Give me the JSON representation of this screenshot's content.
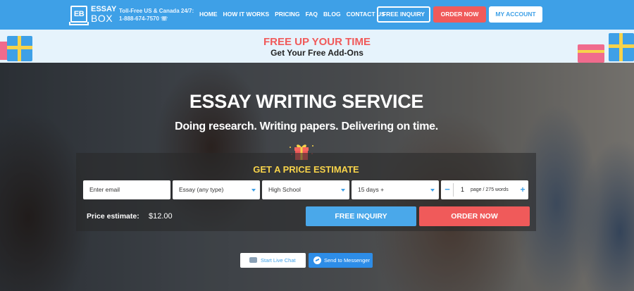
{
  "brand": {
    "logo_mark": "EB",
    "logo_line1": "ESSAY",
    "logo_line2": "BOX"
  },
  "contact": {
    "label": "Toll-Free US & Canada 24/7:",
    "phone": "1-888-674-7570"
  },
  "nav": [
    "HOME",
    "HOW IT WORKS",
    "PRICING",
    "FAQ",
    "BLOG",
    "CONTACT US"
  ],
  "header_buttons": {
    "free_inquiry": "FREE INQUIRY",
    "order_now": "ORDER NOW",
    "my_account": "MY ACCOUNT"
  },
  "promo": {
    "title": "FREE UP YOUR TIME",
    "subtitle": "Get Your Free Add-Ons"
  },
  "hero": {
    "title": "ESSAY WRITING SERVICE",
    "subtitle": "Doing research. Writing papers. Delivering on time."
  },
  "estimate": {
    "title": "GET A PRICE ESTIMATE",
    "email_placeholder": "Enter email",
    "paper_type": "Essay (any type)",
    "level": "High School",
    "deadline": "15 days +",
    "pages": "1",
    "pages_unit": "page / 275 words",
    "price_label": "Price estimate:",
    "price_value": "$12.00",
    "free_inquiry": "FREE INQUIRY",
    "order_now": "ORDER NOW"
  },
  "chat": {
    "live_chat": "Start Live Chat",
    "messenger": "Send to Messenger"
  },
  "colors": {
    "primary": "#3ea0e7",
    "accent": "#f05a5a",
    "highlight": "#f7d34a"
  }
}
